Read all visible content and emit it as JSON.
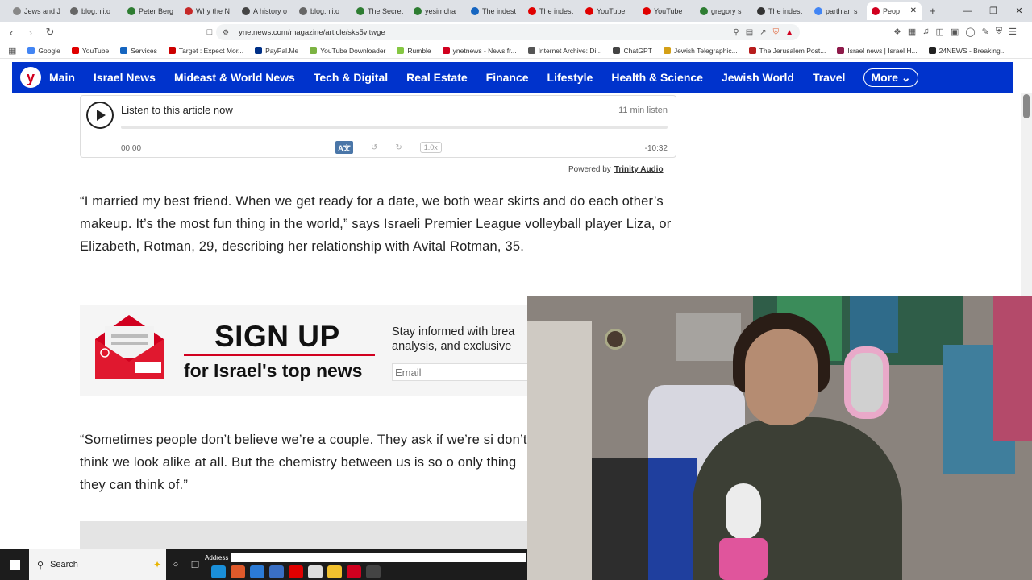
{
  "browser": {
    "tabs": [
      {
        "label": "Jews and J",
        "color": "#888888"
      },
      {
        "label": "blog.nli.o",
        "color": "#666666"
      },
      {
        "label": "Peter Berg",
        "color": "#2e7d32"
      },
      {
        "label": "Why the N",
        "color": "#c62828"
      },
      {
        "label": "A history o",
        "color": "#444444"
      },
      {
        "label": "blog.nli.o",
        "color": "#666666"
      },
      {
        "label": "The Secret",
        "color": "#2e7d32"
      },
      {
        "label": "yesimcha",
        "color": "#2e7d32"
      },
      {
        "label": "The indest",
        "color": "#1565c0"
      },
      {
        "label": "The indest",
        "color": "#e00000"
      },
      {
        "label": "YouTube",
        "color": "#e00000"
      },
      {
        "label": "YouTube",
        "color": "#e00000"
      },
      {
        "label": "gregory s",
        "color": "#2e7d32"
      },
      {
        "label": "The indest",
        "color": "#333333"
      },
      {
        "label": "parthian s",
        "color": "#4285f4"
      },
      {
        "label": "Peop",
        "color": "#d1001f"
      }
    ],
    "new_tab": "+",
    "url": "ynetnews.com/magazine/article/sks5vitwge",
    "bookmarks": [
      {
        "label": "Google",
        "color": "#4285f4"
      },
      {
        "label": "YouTube",
        "color": "#e00000"
      },
      {
        "label": "Services",
        "color": "#1565c0"
      },
      {
        "label": "Target : Expect Mor...",
        "color": "#cc0000"
      },
      {
        "label": "PayPal.Me",
        "color": "#003087"
      },
      {
        "label": "YouTube Downloader",
        "color": "#7cb342"
      },
      {
        "label": "Rumble",
        "color": "#85c742"
      },
      {
        "label": "ynetnews - News fr...",
        "color": "#d1001f"
      },
      {
        "label": "Internet Archive: Di...",
        "color": "#555555"
      },
      {
        "label": "ChatGPT",
        "color": "#444444"
      },
      {
        "label": "Jewish Telegraphic...",
        "color": "#d4a017"
      },
      {
        "label": "The Jerusalem Post...",
        "color": "#b71c1c"
      },
      {
        "label": "Israel news | Israel H...",
        "color": "#8e1a4a"
      },
      {
        "label": "24NEWS - Breaking...",
        "color": "#222222"
      }
    ]
  },
  "site": {
    "logo": "y",
    "nav": [
      "Main",
      "Israel News",
      "Mideast & World News",
      "Tech & Digital",
      "Real Estate",
      "Finance",
      "Lifestyle",
      "Health & Science",
      "Jewish World",
      "Travel"
    ],
    "more": "More",
    "brand_color": "#0033cc"
  },
  "player": {
    "title": "Listen to this article now",
    "duration": "11 min listen",
    "time_current": "00:00",
    "time_remaining": "-10:32",
    "rate": "1.0x",
    "powered_by": "Powered by",
    "provider": "Trinity Audio"
  },
  "article": {
    "para1": "“I married my best friend. When we get ready for a date, we both wear skirts and do each other’s makeup. It’s the most fun thing in the world,” says Israeli Premier League volleyball player Liza, or Elizabeth, Rotman, 29, describing her relationship with Avital Rotman, 35.",
    "para2": "“Sometimes people don’t believe we’re a couple. They ask if we’re si don’t think we look alike at all. But the chemistry between us is so o only thing they can think of.”"
  },
  "signup": {
    "title": "SIGN UP",
    "subtitle": "for Israel's top news",
    "desc_line1": "Stay informed with brea",
    "desc_line2": "analysis, and exclusive",
    "email_placeholder": "Email"
  },
  "taskbar": {
    "search": "Search",
    "address_label": "Address"
  }
}
